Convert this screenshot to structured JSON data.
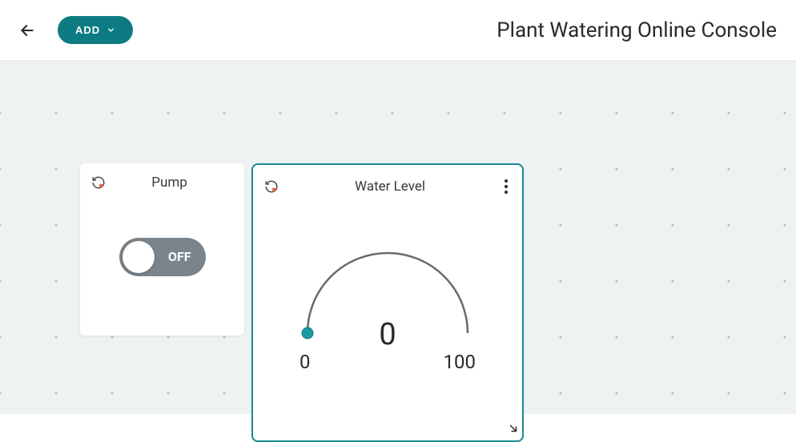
{
  "header": {
    "add_label": "ADD",
    "title": "Plant Watering Online Console"
  },
  "widgets": {
    "pump": {
      "title": "Pump",
      "toggle_state": "OFF"
    },
    "water_level": {
      "title": "Water Level",
      "value": "0",
      "min_label": "0",
      "max_label": "100"
    }
  },
  "colors": {
    "accent": "#0e7b83",
    "selected_border": "#1b8a94",
    "toggle_off": "#7b848a"
  },
  "chart_data": {
    "type": "gauge",
    "title": "Water Level",
    "value": 0,
    "min": 0,
    "max": 100
  }
}
